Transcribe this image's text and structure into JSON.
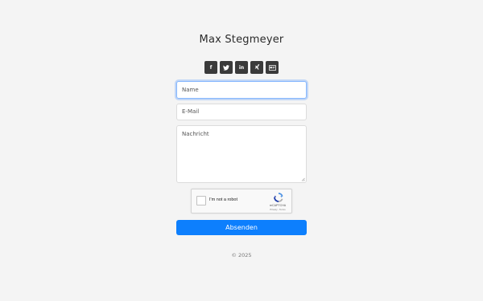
{
  "header": {
    "title": "Max Stegmeyer"
  },
  "social": [
    {
      "icon": "facebook-icon",
      "glyph": "f"
    },
    {
      "icon": "twitter-icon",
      "glyph": ""
    },
    {
      "icon": "linkedin-icon",
      "glyph": "in"
    },
    {
      "icon": "xing-icon",
      "glyph": ""
    },
    {
      "icon": "id-card-icon",
      "glyph": ""
    }
  ],
  "form": {
    "name_placeholder": "Name",
    "email_placeholder": "E-Mail",
    "message_placeholder": "Nachricht",
    "captcha_label": "I'm not a robot",
    "captcha_brand": "reCAPTCHA",
    "captcha_terms": "Privacy - Terms",
    "submit_label": "Absenden"
  },
  "footer": {
    "copyright": "© 2025"
  },
  "colors": {
    "background": "#f4f4f4",
    "accent": "#0d7ffd",
    "social_button": "#3a3a3a"
  }
}
